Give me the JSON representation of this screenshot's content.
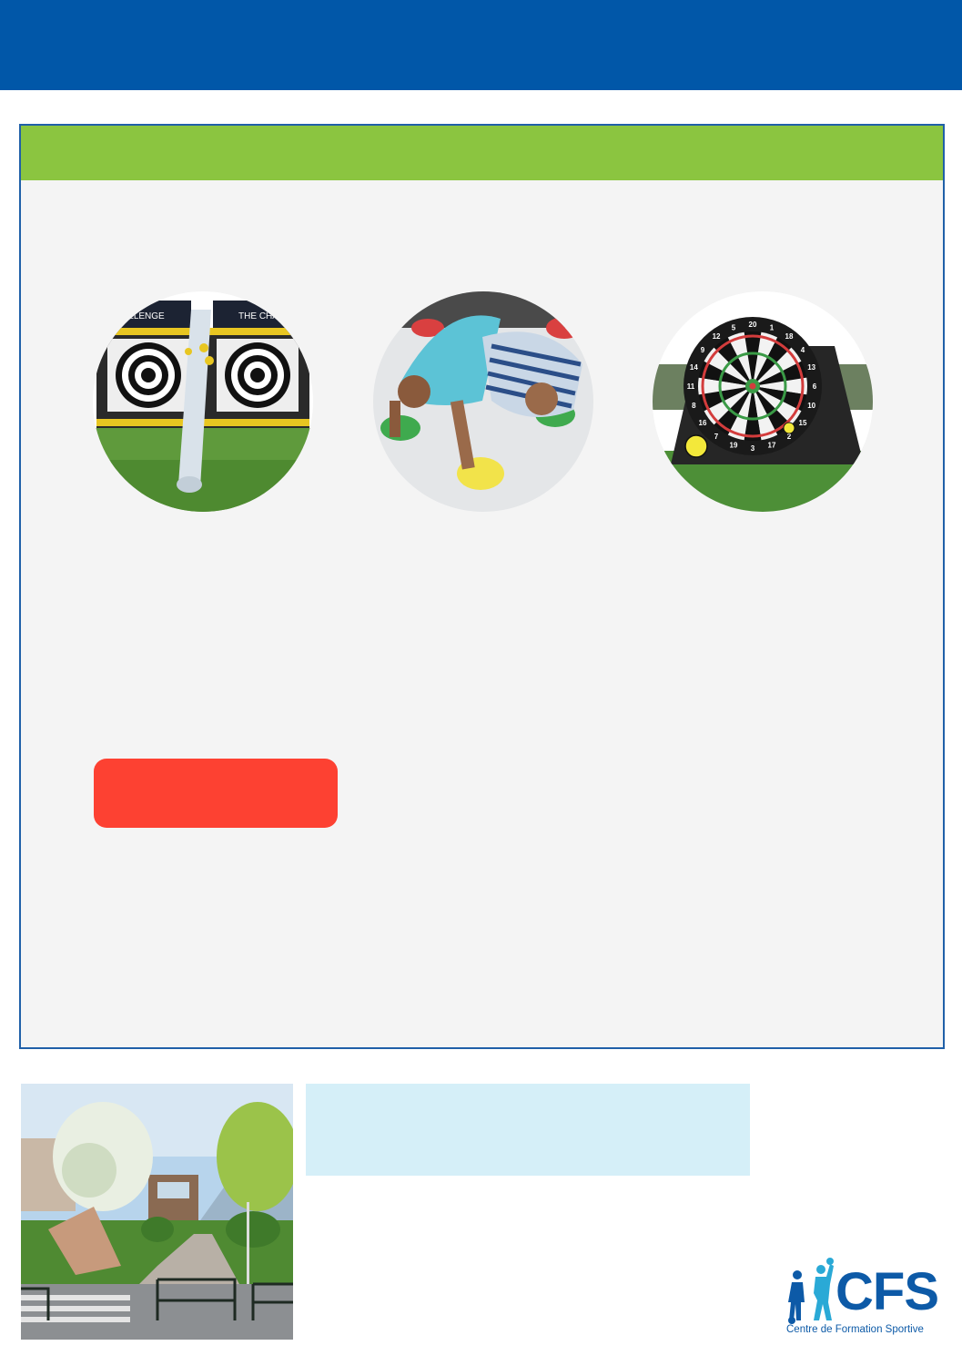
{
  "colors": {
    "header": "#0157a8",
    "panel_header": "#8bc540",
    "panel_bg": "#f4f4f4",
    "panel_border": "#2060a8",
    "button": "#fd4132",
    "info_box": "#d5eff8",
    "logo": "#0d5aa7",
    "logo_figures": "#2aa9d6"
  },
  "panel": {
    "photos": [
      {
        "name": "inflatable-target-challenge",
        "sign_left": "LLENGE",
        "sign_right": "THE CHA"
      },
      {
        "name": "giant-twister-game"
      },
      {
        "name": "inflatable-football-darts",
        "board_numbers": [
          "20",
          "1",
          "18",
          "4",
          "13",
          "6",
          "10",
          "15",
          "2",
          "17",
          "3",
          "19",
          "7",
          "16",
          "8",
          "11",
          "14",
          "9",
          "12",
          "5"
        ]
      }
    ]
  },
  "footer": {
    "photo": "sports-centre-entrance"
  },
  "logo": {
    "name": "CFS",
    "subtitle": "Centre de Formation Sportive"
  }
}
